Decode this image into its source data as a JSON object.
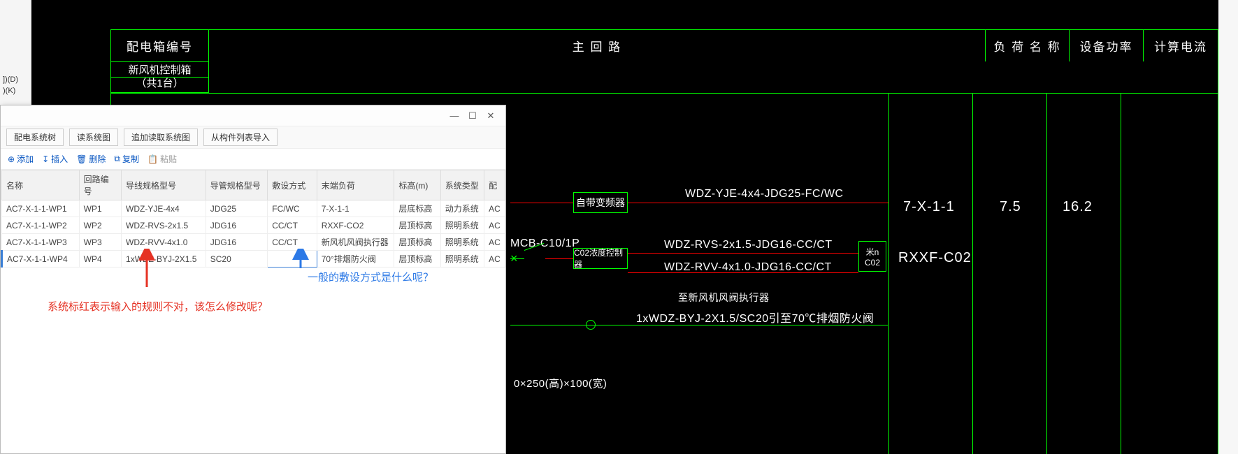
{
  "left_panel": {
    "item1": "])(D)",
    "item2": ")(K)"
  },
  "cad_header": {
    "col_box_id": "配电箱编号",
    "col_main": "主 回 路",
    "col_load_name": "负 荷 名 称",
    "col_power": "设备功率",
    "col_current": "计算电流",
    "sub_name1": "新风机控制箱",
    "sub_name2": "（共1台）"
  },
  "cad_values": {
    "row1_name": "7-X-1-1",
    "row1_power": "7.5",
    "row1_current": "16.2",
    "row2_name": "RXXF-C02"
  },
  "cad_drawing": {
    "wire1": "WDZ-YJE-4x4-JDG25-FC/WC",
    "breaker": "MCB-C10/1P",
    "wire2": "WDZ-RVS-2x1.5-JDG16-CC/CT",
    "wire3": "WDZ-RVV-4x1.0-JDG16-CC/CT",
    "actuator_note": "至新风机风阀执行器",
    "wire4_full": "1xWDZ-BYJ-2X1.5/SC20引至70℃排烟防火阀",
    "dims": "0×250(高)×100(宽)",
    "box1": "自带变频器",
    "box2": "C02浓度控制器",
    "box3_top": "米n",
    "box3_bottom": "C02"
  },
  "dialog": {
    "tabs": {
      "t1": "配电系统树",
      "t2": "读系统图",
      "t3": "追加读取系统图",
      "t4": "从构件列表导入"
    },
    "actions": {
      "add": "添加",
      "insert": "插入",
      "delete": "删除",
      "copy": "复制",
      "paste": "粘贴"
    },
    "cols": {
      "c1": "名称",
      "c2": "回路编号",
      "c3": "导线规格型号",
      "c4": "导管规格型号",
      "c5": "敷设方式",
      "c6": "末端负荷",
      "c7": "标高(m)",
      "c8": "系统类型",
      "c9": "配"
    },
    "rows": [
      {
        "name": "AC7-X-1-1-WP1",
        "loop": "WP1",
        "wire": "WDZ-YJE-4x4",
        "pipe": "JDG25",
        "lay": "FC/WC",
        "end": "7-X-1-1",
        "elev": "层底标高",
        "sys": "动力系统",
        "last": "AC"
      },
      {
        "name": "AC7-X-1-1-WP2",
        "loop": "WP2",
        "wire": "WDZ-RVS-2x1.5",
        "pipe": "JDG16",
        "lay": "CC/CT",
        "end": "RXXF-CO2",
        "elev": "层顶标高",
        "sys": "照明系统",
        "last": "AC"
      },
      {
        "name": "AC7-X-1-1-WP3",
        "loop": "WP3",
        "wire": "WDZ-RVV-4x1.0",
        "pipe": "JDG16",
        "lay": "CC/CT",
        "end": "新风机风阀执行器",
        "elev": "层顶标高",
        "sys": "照明系统",
        "last": "AC"
      },
      {
        "name": "AC7-X-1-1-WP4",
        "loop": "WP4",
        "wire": "1xWDZ-BYJ-2X1.5",
        "pipe": "SC20",
        "lay": "",
        "end": "70°排烟防火阀",
        "elev": "层顶标高",
        "sys": "照明系统",
        "last": "AC"
      }
    ]
  },
  "annotations": {
    "red_text": "系统标红表示输入的规则不对，该怎么修改呢？",
    "blue_text": "一般的敷设方式是什么呢？"
  }
}
